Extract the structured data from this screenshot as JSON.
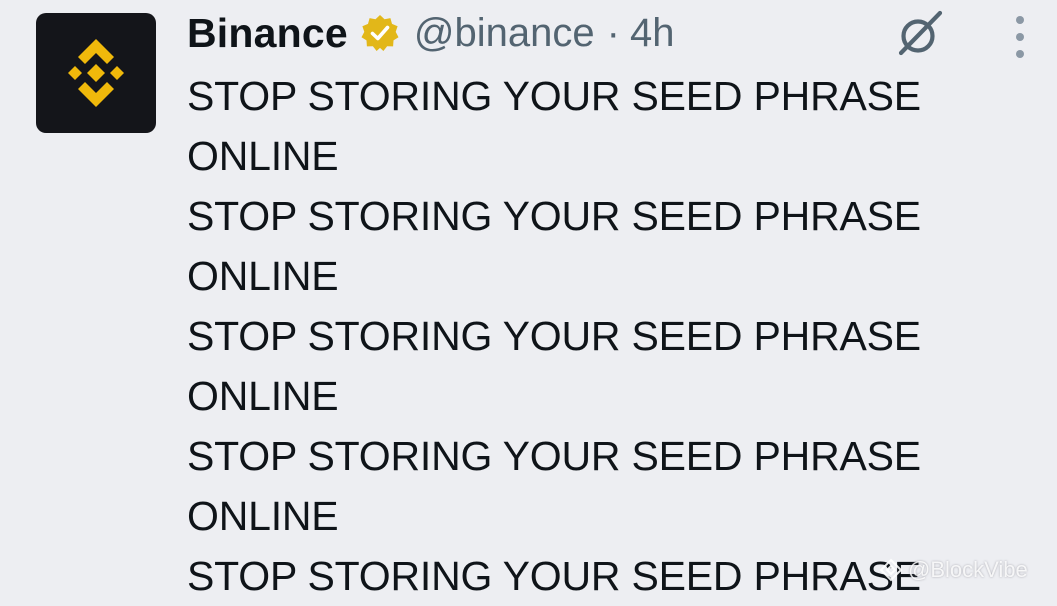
{
  "author": {
    "name": "Binance",
    "handle": "@binance",
    "separator": "·",
    "time": "4h",
    "avatar_icon": "binance-logo-icon",
    "verified_icon": "verified-badge-icon",
    "brand_color": "#f0b90b"
  },
  "actions": {
    "grok_icon": "grok-icon",
    "more_icon": "more-options-icon"
  },
  "tweet": {
    "lines": [
      "STOP STORING YOUR SEED PHRASE",
      "ONLINE",
      "STOP STORING YOUR SEED PHRASE",
      "ONLINE",
      "STOP STORING YOUR SEED PHRASE",
      "ONLINE",
      "STOP STORING YOUR SEED PHRASE",
      "ONLINE",
      "STOP STORING YOUR SEED PHRASE"
    ]
  },
  "watermark": {
    "text": "@BlockVibe",
    "icon": "binance-square-icon"
  }
}
